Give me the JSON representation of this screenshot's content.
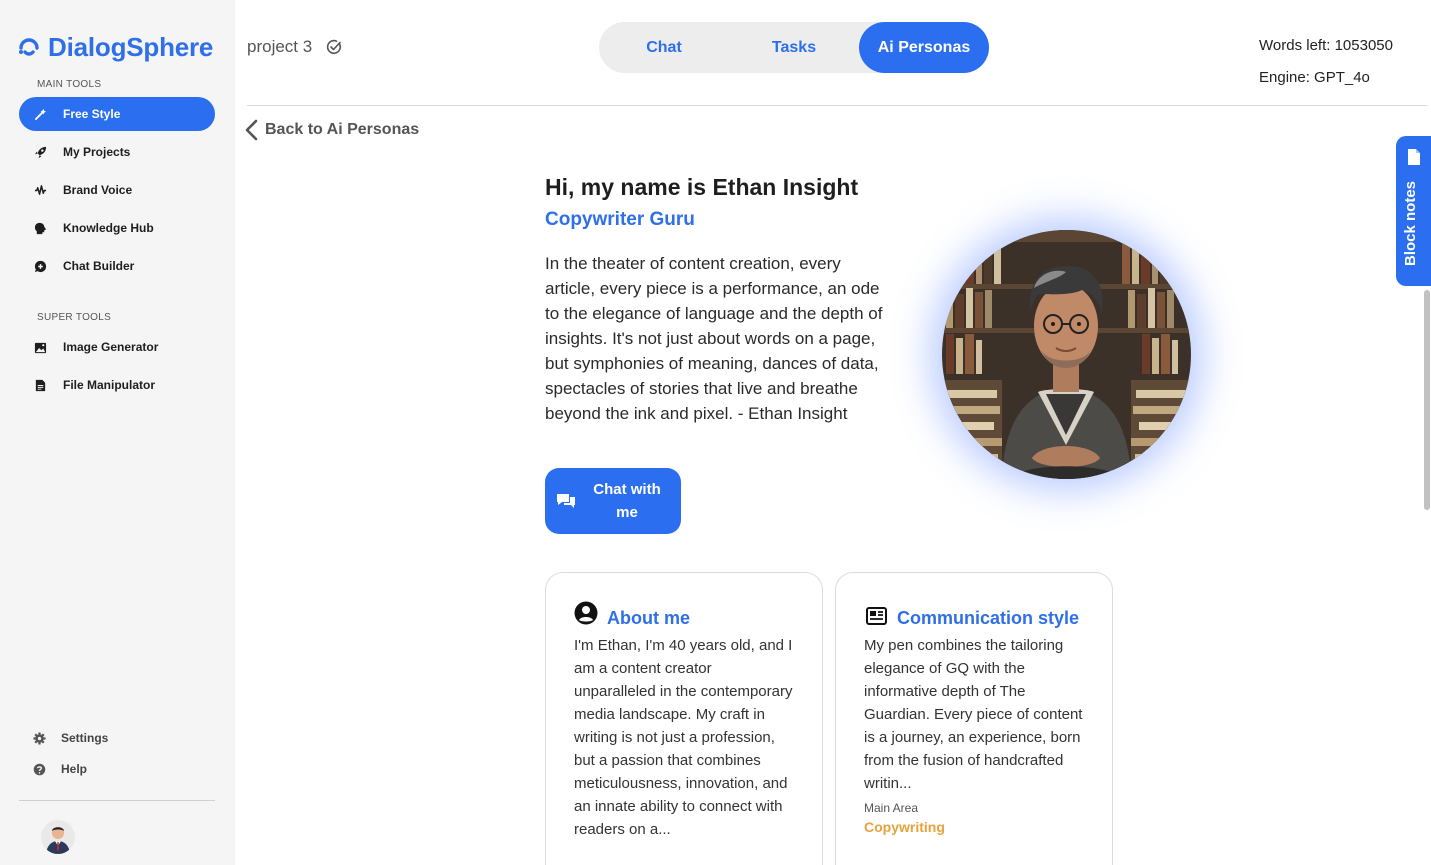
{
  "app": {
    "logo_text": "DialogSphere",
    "brand_color": "#2b6ff0"
  },
  "sidebar": {
    "main_tools_label": "MAIN TOOLS",
    "super_tools_label": "SUPER TOOLS",
    "main_items": [
      {
        "label": "Free Style",
        "icon": "wand-icon",
        "active": true
      },
      {
        "label": "My Projects",
        "icon": "rocket-icon"
      },
      {
        "label": "Brand Voice",
        "icon": "waveform-icon"
      },
      {
        "label": "Knowledge Hub",
        "icon": "brain-icon"
      },
      {
        "label": "Chat Builder",
        "icon": "chat-plus-icon"
      }
    ],
    "super_items": [
      {
        "label": "Image Generator",
        "icon": "image-icon"
      },
      {
        "label": "File Manipulator",
        "icon": "file-icon"
      }
    ],
    "settings_label": "Settings",
    "help_label": "Help"
  },
  "header": {
    "project_name": "project 3",
    "tabs": [
      {
        "label": "Chat"
      },
      {
        "label": "Tasks"
      },
      {
        "label": "Ai Personas",
        "active": true
      }
    ],
    "words_left": "Words left: 1053050",
    "engine": "Engine: GPT_4o"
  },
  "back_label": "Back to Ai Personas",
  "persona": {
    "greeting": "Hi, my name is Ethan Insight",
    "role": "Copywriter Guru",
    "quote": "In the theater of content creation, every article, every piece is a performance, an ode to the elegance of language and the depth of insights. It's not just about words on a page, but symphonies of meaning, dances of data, spectacles of stories that live and breathe beyond the ink and pixel. - Ethan Insight",
    "chat_button": "Chat with me"
  },
  "cards": {
    "about": {
      "title": "About me",
      "text": "I'm Ethan, I'm 40 years old, and I am a content creator unparalleled in the contemporary media landscape. My craft in writing is not just a profession, but a passion that combines meticulousness, innovation, and an innate ability to connect with readers on a..."
    },
    "communication": {
      "title": "Communication style",
      "text": "My pen combines the tailoring elegance of GQ with the informative depth of The Guardian. Every piece of content is a journey, an experience, born from the fusion of handcrafted writin...",
      "main_area_label": "Main Area",
      "main_area_value": "Copywriting"
    }
  },
  "block_notes_label": "Block notes"
}
